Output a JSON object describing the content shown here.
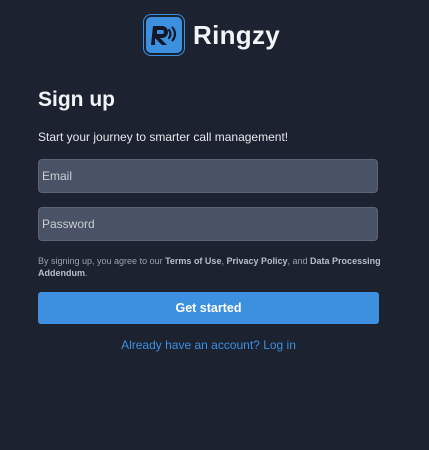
{
  "brand": {
    "name": "Ringzy",
    "logo_icon": "ringzy-logo-icon",
    "accent_color": "#3d8fe0"
  },
  "form": {
    "title": "Sign up",
    "subtitle": "Start your journey to smarter call management!",
    "email": {
      "placeholder": "Email",
      "value": ""
    },
    "password": {
      "placeholder": "Password",
      "value": ""
    },
    "terms": {
      "prefix": "By signing up, you agree to our ",
      "terms_of_use": "Terms of Use",
      "sep1": ", ",
      "privacy_policy": "Privacy Policy",
      "sep2": ", and ",
      "data_processing": "Data Processing Addendum",
      "suffix": "."
    },
    "submit_label": "Get started",
    "login_link": "Already have an account? Log in"
  }
}
